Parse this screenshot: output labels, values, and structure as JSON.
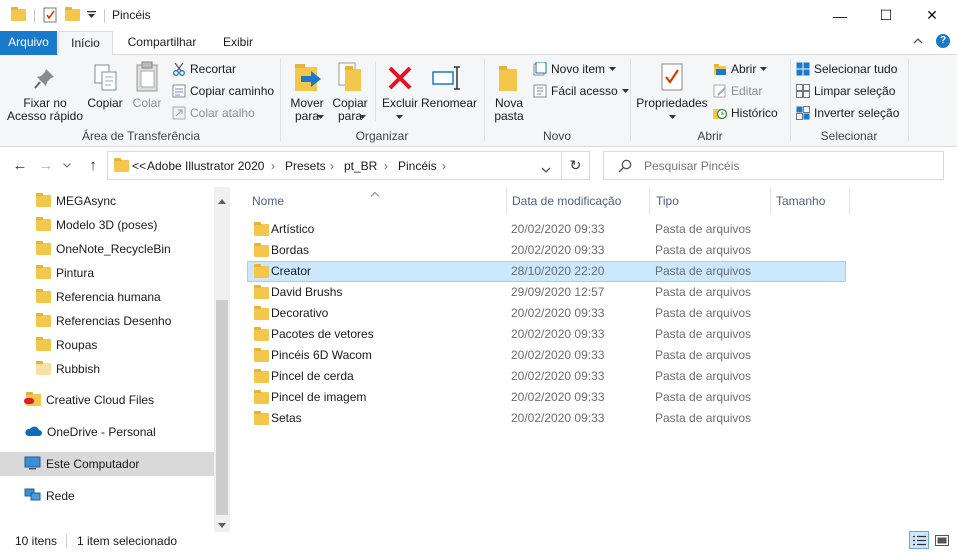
{
  "window": {
    "title": "Pincéis",
    "minimize": "—",
    "maximize": "☐",
    "close": "✕"
  },
  "ribbon_tabs": [
    {
      "label": "Arquivo"
    },
    {
      "label": "Início"
    },
    {
      "label": "Compartilhar"
    },
    {
      "label": "Exibir"
    }
  ],
  "ribbon": {
    "clipboard": {
      "pin_line1": "Fixar no",
      "pin_line2": "Acesso rápido",
      "copy": "Copiar",
      "paste": "Colar",
      "cut": "Recortar",
      "copy_path": "Copiar caminho",
      "paste_shortcut": "Colar atalho",
      "group": "Área de Transferência"
    },
    "organize": {
      "move_line1": "Mover",
      "move_line2": "para",
      "copy_line1": "Copiar",
      "copy_line2": "para",
      "delete": "Excluir",
      "rename": "Renomear",
      "group": "Organizar"
    },
    "new": {
      "new_folder_line1": "Nova",
      "new_folder_line2": "pasta",
      "new_item": "Novo item",
      "easy_access": "Fácil acesso",
      "group": "Novo"
    },
    "open": {
      "properties": "Propriedades",
      "open": "Abrir",
      "edit": "Editar",
      "history": "Histórico",
      "group": "Abrir"
    },
    "select": {
      "select_all": "Selecionar tudo",
      "select_none": "Limpar seleção",
      "invert": "Inverter seleção",
      "group": "Selecionar"
    }
  },
  "address": {
    "overflow": "<<",
    "crumbs": [
      "Adobe Illustrator 2020",
      "Presets",
      "pt_BR",
      "Pincéis"
    ],
    "separator": "›",
    "search_placeholder": "Pesquisar Pincéis"
  },
  "nav_pane": [
    {
      "label": "MEGAsync"
    },
    {
      "label": "Modelo 3D (poses)"
    },
    {
      "label": "OneNote_RecycleBin"
    },
    {
      "label": "Pintura"
    },
    {
      "label": "Referencia humana"
    },
    {
      "label": "Referencias Desenho"
    },
    {
      "label": "Roupas"
    },
    {
      "label": "Rubbish"
    },
    {
      "label": "Creative Cloud Files"
    },
    {
      "label": "OneDrive - Personal"
    },
    {
      "label": "Este Computador"
    },
    {
      "label": "Rede"
    }
  ],
  "columns": {
    "name": "Nome",
    "date": "Data de modificação",
    "type": "Tipo",
    "size": "Tamanho"
  },
  "files": [
    {
      "name": "Artístico",
      "date": "20/02/2020 09:33",
      "type": "Pasta de arquivos"
    },
    {
      "name": "Bordas",
      "date": "20/02/2020 09:33",
      "type": "Pasta de arquivos"
    },
    {
      "name": "Creator",
      "date": "28/10/2020 22:20",
      "type": "Pasta de arquivos"
    },
    {
      "name": "David Brushs",
      "date": "29/09/2020 12:57",
      "type": "Pasta de arquivos"
    },
    {
      "name": "Decorativo",
      "date": "20/02/2020 09:33",
      "type": "Pasta de arquivos"
    },
    {
      "name": "Pacotes de vetores",
      "date": "20/02/2020 09:33",
      "type": "Pasta de arquivos"
    },
    {
      "name": "Pincéis 6D Wacom",
      "date": "20/02/2020 09:33",
      "type": "Pasta de arquivos"
    },
    {
      "name": "Pincel de cerda",
      "date": "20/02/2020 09:33",
      "type": "Pasta de arquivos"
    },
    {
      "name": "Pincel de imagem",
      "date": "20/02/2020 09:33",
      "type": "Pasta de arquivos"
    },
    {
      "name": "Setas",
      "date": "20/02/2020 09:33",
      "type": "Pasta de arquivos"
    }
  ],
  "status": {
    "count": "10 itens",
    "selected": "1 item selecionado"
  },
  "colors": {
    "accent": "#1979ca",
    "selection": "#cce8ff",
    "folder": "#f3c74b"
  }
}
